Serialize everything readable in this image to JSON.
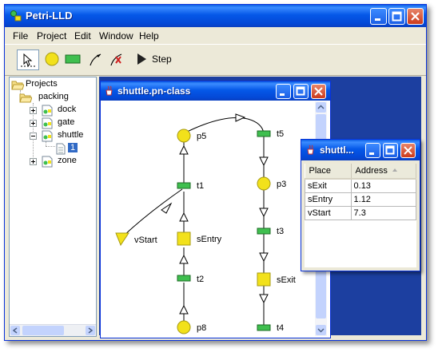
{
  "app": {
    "title": "Petri-LLD"
  },
  "menu": [
    "File",
    "Project",
    "Edit",
    "Window",
    "Help"
  ],
  "toolbar": {
    "step_label": "Step"
  },
  "tree": {
    "root": "Projects",
    "items": [
      {
        "label": "packing"
      },
      {
        "label": "dock"
      },
      {
        "label": "gate"
      },
      {
        "label": "shuttle"
      },
      {
        "label": "1"
      },
      {
        "label": "zone"
      }
    ]
  },
  "net_window": {
    "title": "shuttle.pn-class",
    "labels": {
      "p5": "p5",
      "t5": "t5",
      "t1": "t1",
      "p3": "p3",
      "vStart": "vStart",
      "sEntry": "sEntry",
      "t3": "t3",
      "t2": "t2",
      "sExit": "sExit",
      "p8": "p8",
      "t4": "t4"
    }
  },
  "table_window": {
    "title": "shuttl...",
    "columns": [
      "Place",
      "Address"
    ],
    "rows": [
      {
        "place": "sExit",
        "address": "0.13"
      },
      {
        "place": "sEntry",
        "address": "1.12"
      },
      {
        "place": "vStart",
        "address": "7.3"
      }
    ]
  },
  "colors": {
    "titlebar": "#0558e8",
    "desktop": "#1c3fa0",
    "place": "#f2e11b",
    "transition": "#3fbf4f"
  }
}
